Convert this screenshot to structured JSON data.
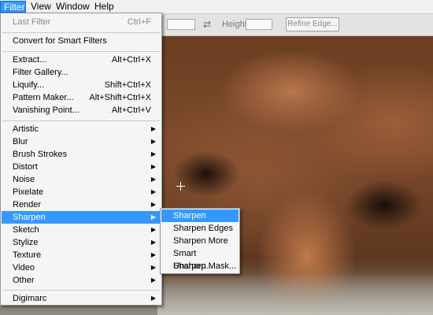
{
  "menubar": {
    "items": [
      {
        "label": "Filter"
      },
      {
        "label": "View"
      },
      {
        "label": "Window"
      },
      {
        "label": "Help"
      }
    ]
  },
  "options_bar": {
    "height_label": "Height:",
    "refine_edge_label": "Refine Edge..."
  },
  "filter_menu": {
    "items": [
      {
        "label": "Last Filter",
        "shortcut": "Ctrl+F",
        "disabled": true
      },
      {
        "label": "Convert for Smart Filters"
      },
      {
        "label": "Extract...",
        "shortcut": "Alt+Ctrl+X"
      },
      {
        "label": "Filter Gallery..."
      },
      {
        "label": "Liquify...",
        "shortcut": "Shift+Ctrl+X"
      },
      {
        "label": "Pattern Maker...",
        "shortcut": "Alt+Shift+Ctrl+X"
      },
      {
        "label": "Vanishing Point...",
        "shortcut": "Alt+Ctrl+V"
      },
      {
        "label": "Artistic",
        "submenu": true
      },
      {
        "label": "Blur",
        "submenu": true
      },
      {
        "label": "Brush Strokes",
        "submenu": true
      },
      {
        "label": "Distort",
        "submenu": true
      },
      {
        "label": "Noise",
        "submenu": true
      },
      {
        "label": "Pixelate",
        "submenu": true
      },
      {
        "label": "Render",
        "submenu": true
      },
      {
        "label": "Sharpen",
        "submenu": true,
        "highlighted": true
      },
      {
        "label": "Sketch",
        "submenu": true
      },
      {
        "label": "Stylize",
        "submenu": true
      },
      {
        "label": "Texture",
        "submenu": true
      },
      {
        "label": "Video",
        "submenu": true
      },
      {
        "label": "Other",
        "submenu": true
      },
      {
        "label": "Digimarc",
        "submenu": true
      }
    ]
  },
  "sharpen_submenu": {
    "items": [
      {
        "label": "Sharpen",
        "highlighted": true
      },
      {
        "label": "Sharpen Edges"
      },
      {
        "label": "Sharpen More"
      },
      {
        "label": "Smart Sharpen..."
      },
      {
        "label": "Unsharp Mask..."
      }
    ]
  },
  "icons": {
    "swap": "swap-arrows-icon",
    "submenu_arrow": "triangle-right-icon",
    "cursor": "crosshair-cursor-icon"
  },
  "colors": {
    "highlight": "#3399ff",
    "menu_bg": "#f5f5f5",
    "menubar_bg": "#f0f0f0"
  }
}
